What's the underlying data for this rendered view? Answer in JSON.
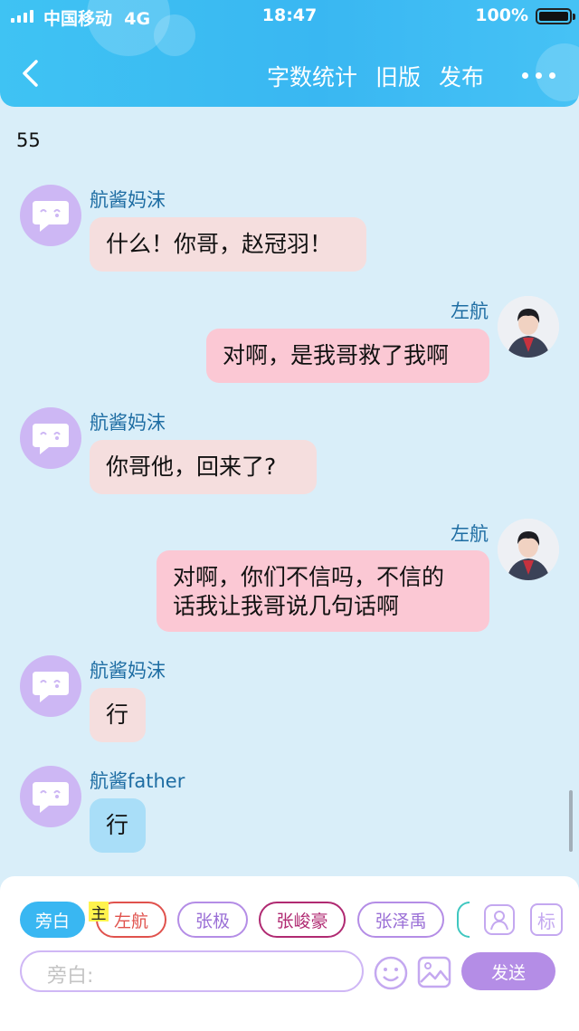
{
  "status_bar": {
    "carrier": "中国移动",
    "network": "4G",
    "time": "18:47",
    "battery": "100%"
  },
  "nav": {
    "back_icon": "chevron-left-icon",
    "actions": [
      "字数统计",
      "旧版",
      "发布"
    ],
    "more_icon": "more-dots-icon"
  },
  "word_count": "55",
  "messages": [
    {
      "side": "left",
      "name": "航酱妈沫",
      "text": "什么！你哥，赵冠羽！"
    },
    {
      "side": "right",
      "name": "左航",
      "text": "对啊，是我哥救了我啊"
    },
    {
      "side": "left",
      "name": "航酱妈沫",
      "text": "你哥他，回来了?"
    },
    {
      "side": "right",
      "name": "左航",
      "line1": "对啊，你们不信吗，不信的",
      "line2": "话我让我哥说几句话啊"
    },
    {
      "side": "left",
      "name": "航酱妈沫",
      "text": "行"
    },
    {
      "side": "left",
      "name": "航酱father",
      "text": "行"
    }
  ],
  "roles": {
    "narration": "旁白",
    "owner_tag": "主",
    "chars": [
      "左航",
      "张极",
      "张峻豪",
      "张泽禹"
    ]
  },
  "composer": {
    "placeholder": "旁白:",
    "send": "发送",
    "tag_button": "标"
  },
  "colors": {
    "header": "#39b7f2",
    "name": "#1e6da3",
    "left_bubble": "#f5dede",
    "right_bubble": "#fbc8d4",
    "blue_bubble": "#a9def8",
    "accent_purple": "#b48de6"
  }
}
